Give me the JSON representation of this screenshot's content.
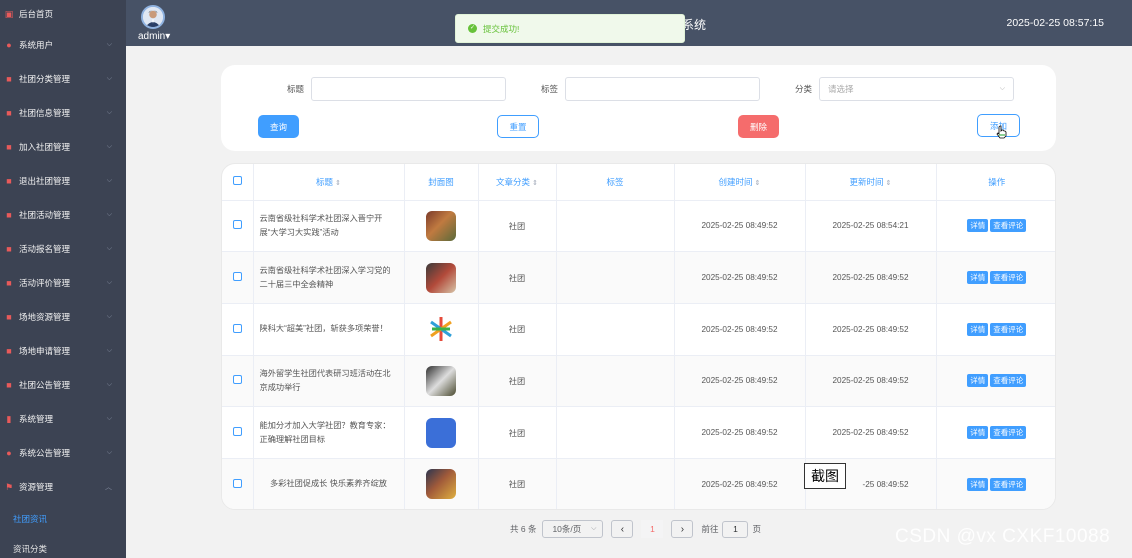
{
  "sidebar": {
    "items": [
      {
        "label": "后台首页",
        "icon": "monitor-icon"
      },
      {
        "label": "系统用户",
        "icon": "user-icon"
      },
      {
        "label": "社团分类管理",
        "icon": "edit-icon"
      },
      {
        "label": "社团信息管理",
        "icon": "edit-icon"
      },
      {
        "label": "加入社团管理",
        "icon": "edit-icon"
      },
      {
        "label": "退出社团管理",
        "icon": "edit-icon"
      },
      {
        "label": "社团活动管理",
        "icon": "edit-icon"
      },
      {
        "label": "活动报名管理",
        "icon": "edit-icon"
      },
      {
        "label": "活动评价管理",
        "icon": "edit-icon"
      },
      {
        "label": "场地资源管理",
        "icon": "edit-icon"
      },
      {
        "label": "场地申请管理",
        "icon": "edit-icon"
      },
      {
        "label": "社团公告管理",
        "icon": "edit-icon"
      },
      {
        "label": "系统管理",
        "icon": "chart-icon"
      },
      {
        "label": "系统公告管理",
        "icon": "info-icon"
      },
      {
        "label": "资源管理",
        "icon": "flag-icon"
      }
    ],
    "sub_items": [
      {
        "label": "社团资讯",
        "active": true
      },
      {
        "label": "资讯分类",
        "active": false
      }
    ]
  },
  "header": {
    "user_name": "admin",
    "title_fragment": "系统",
    "datetime": "2025-02-25 08:57:15"
  },
  "toast": {
    "message": "提交成功!"
  },
  "search": {
    "title_label": "标题",
    "tag_label": "标签",
    "category_label": "分类",
    "category_placeholder": "请选择",
    "query_button": "查询",
    "reset_button": "重置",
    "delete_button": "删除",
    "add_button": "添加"
  },
  "table": {
    "headers": {
      "title": "标题",
      "cover": "封面图",
      "category": "文章分类",
      "tag": "标签",
      "created": "创建时间",
      "updated": "更新时间",
      "ops": "操作"
    },
    "detail_button": "详情",
    "comment_button": "查看评论",
    "rows": [
      {
        "title": "云南省级社科学术社团深入晋宁开展“大学习大实践”活动",
        "category": "社团",
        "tag": "",
        "created": "2025-02-25 08:49:52",
        "updated": "2025-02-25 08:54:21"
      },
      {
        "title": "云南省级社科学术社团深入学习党的二十届三中全会精神",
        "category": "社团",
        "tag": "",
        "created": "2025-02-25 08:49:52",
        "updated": "2025-02-25 08:49:52"
      },
      {
        "title": "陕科大“超美”社团，斩获多项荣誉！",
        "category": "社团",
        "tag": "",
        "created": "2025-02-25 08:49:52",
        "updated": "2025-02-25 08:49:52"
      },
      {
        "title": "海外留学生社团代表研习班活动在北京成功举行",
        "category": "社团",
        "tag": "",
        "created": "2025-02-25 08:49:52",
        "updated": "2025-02-25 08:49:52"
      },
      {
        "title": "能加分才加入大学社团？教育专家：正确理解社团目标",
        "category": "社团",
        "tag": "",
        "created": "2025-02-25 08:49:52",
        "updated": "2025-02-25 08:49:52"
      },
      {
        "title": "多彩社团促成长 快乐素养齐绽放",
        "category": "社团",
        "tag": "",
        "created": "2025-02-25 08:49:52",
        "updated": "-25 08:49:52"
      }
    ]
  },
  "pagination": {
    "total": "共 6 条",
    "page_size": "10条/页",
    "current_page": "1",
    "goto_prefix": "前往",
    "goto_value": "1",
    "goto_suffix": "页"
  },
  "overlay": {
    "stamp": "截图",
    "watermark": "CSDN @vx  CXKF10088"
  },
  "colors": {
    "sidebar_bg": "#3c4353",
    "header_bg": "#475266",
    "primary": "#409eff",
    "danger": "#f56c6c",
    "success": "#67c23a"
  }
}
